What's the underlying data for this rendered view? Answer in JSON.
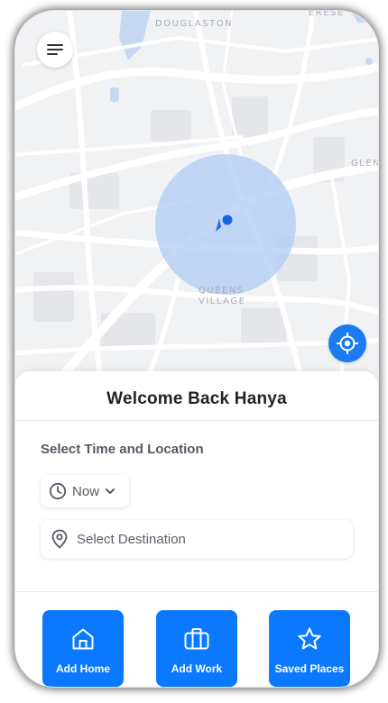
{
  "map": {
    "labels": {
      "top": "DOUGLASTON",
      "top_right": "ERESE",
      "right": "GLEN",
      "center_line1": "QUEENS",
      "center_line2": "VILLAGE"
    },
    "colors": {
      "background": "#f1f2f4",
      "accuracy_circle": "#aecbf3",
      "user_dot": "#1565e0",
      "locate_button": "#1a7cf0"
    }
  },
  "header": {
    "menu_icon": "hamburger-icon"
  },
  "locate_button": {
    "icon": "crosshair-icon"
  },
  "sheet": {
    "welcome": "Welcome Back Hanya",
    "section_title": "Select Time and Location",
    "time": {
      "label": "Now",
      "icon": "clock-icon",
      "dropdown_icon": "chevron-down-icon"
    },
    "destination": {
      "placeholder": "Select Destination",
      "icon": "location-pin-icon"
    },
    "tiles": [
      {
        "label": "Add Home",
        "icon": "home-icon"
      },
      {
        "label": "Add Work",
        "icon": "briefcase-icon"
      },
      {
        "label": "Saved Places",
        "icon": "star-icon"
      }
    ],
    "accent": "#0a78ff"
  }
}
